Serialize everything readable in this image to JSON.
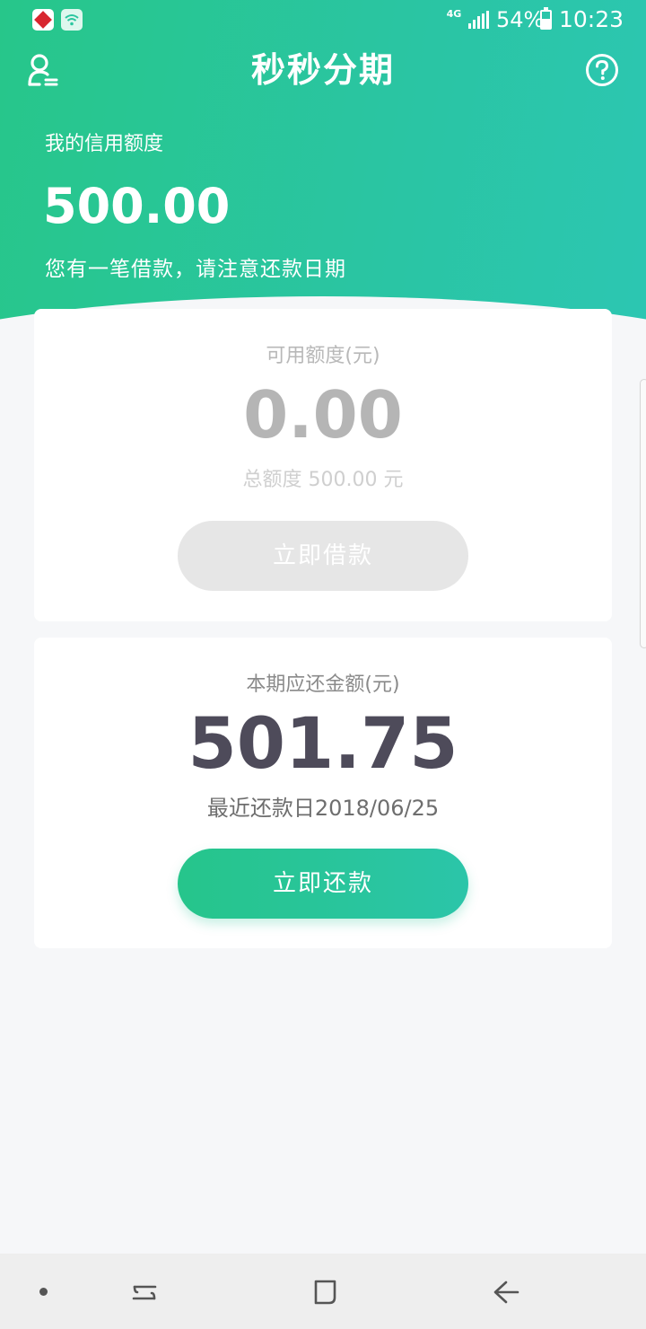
{
  "status_bar": {
    "network": "4G",
    "battery": "54%",
    "time": "10:23",
    "icons": [
      "app-notification-icon",
      "wifi-notification-icon",
      "signal-icon",
      "battery-icon"
    ]
  },
  "header": {
    "title": "秒秒分期",
    "left_icon": "user-icon",
    "right_icon": "help-icon"
  },
  "credit": {
    "label": "我的信用额度",
    "amount": "500.00",
    "notice": "您有一笔借款，请注意还款日期"
  },
  "available_card": {
    "label": "可用额度(元)",
    "amount": "0.00",
    "total_line": "总额度 500.00 元",
    "button": "立即借款"
  },
  "repay_card": {
    "label": "本期应还金额(元)",
    "amount": "501.75",
    "due_line": "最近还款日2018/06/25",
    "button": "立即还款"
  },
  "nav_bar": {
    "icons": [
      "nav-dot-icon",
      "recent-apps-icon",
      "home-icon",
      "back-icon"
    ]
  },
  "colors": {
    "brand_green": "#27c68a",
    "brand_teal": "#2cc6b2",
    "disabled_button": "#e6e6e6",
    "amount_dark": "#4e4b5a"
  }
}
